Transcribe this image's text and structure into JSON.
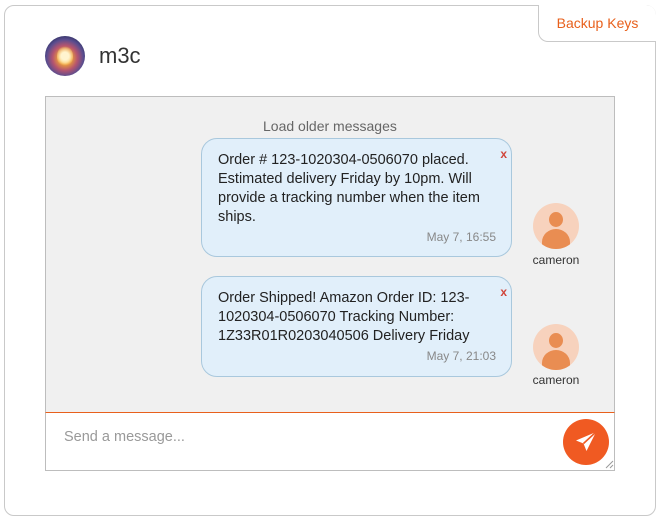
{
  "header": {
    "backup_keys_label": "Backup Keys",
    "username": "m3c"
  },
  "chat": {
    "load_older_label": "Load older messages",
    "messages": [
      {
        "text": "Order # 123-1020304-0506070 placed. Estimated delivery Friday by 10pm. Will provide a tracking number when the item ships.",
        "time": "May 7, 16:55",
        "sender": "cameron",
        "delete_label": "x"
      },
      {
        "text": "Order Shipped! Amazon Order ID: 123-1020304-0506070 Tracking Number: 1Z33R01R0203040506 Delivery Friday",
        "time": "May 7, 21:03",
        "sender": "cameron",
        "delete_label": "x"
      }
    ]
  },
  "composer": {
    "placeholder": "Send a message...",
    "value": "",
    "send_icon": "paper-plane-icon"
  },
  "colors": {
    "accent": "#f05a22",
    "accent_text": "#e8601c",
    "bubble_bg": "#e1effa",
    "bubble_border": "#a9c8dd",
    "panel_bg": "#f0f0f0",
    "delete_color": "#d0453a",
    "avatar_bg": "#f7d2bd",
    "avatar_fg": "#e98d52"
  }
}
